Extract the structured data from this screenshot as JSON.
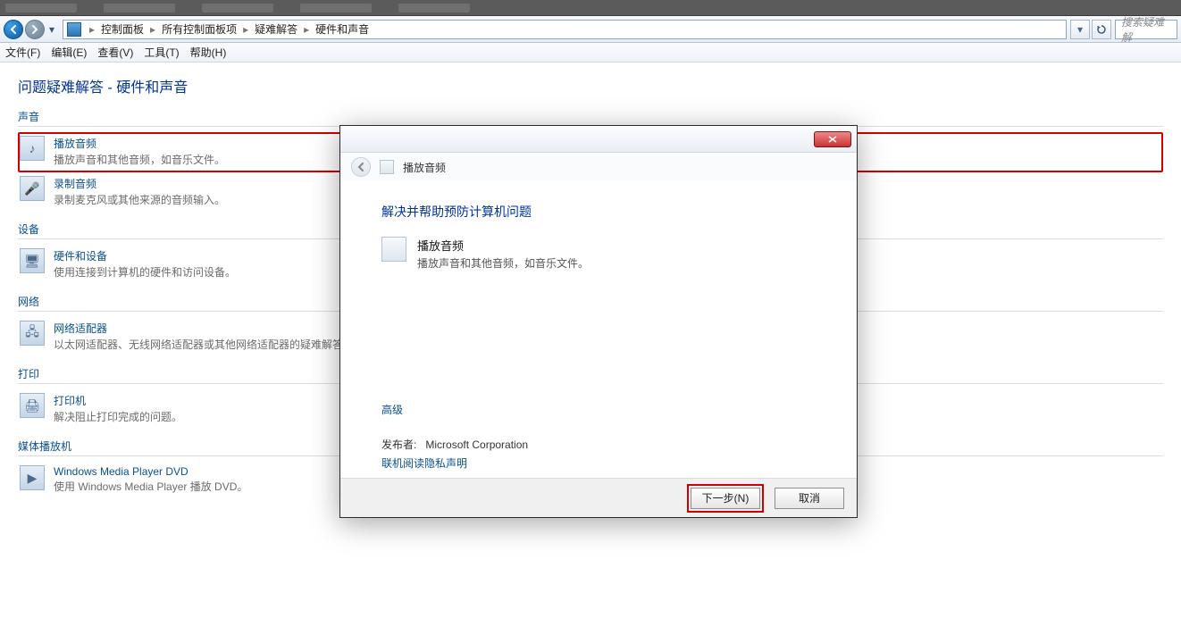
{
  "breadcrumb": {
    "parts": [
      "控制面板",
      "所有控制面板项",
      "疑难解答",
      "硬件和声音"
    ]
  },
  "search": {
    "placeholder": "搜索疑难解"
  },
  "menu": {
    "file": "文件(F)",
    "edit": "编辑(E)",
    "view": "查看(V)",
    "tools": "工具(T)",
    "help": "帮助(H)"
  },
  "page_title": "问题疑难解答 - 硬件和声音",
  "sections": {
    "sound": {
      "header": "声音",
      "items": [
        {
          "title": "播放音频",
          "desc": "播放声音和其他音频，如音乐文件。"
        },
        {
          "title": "录制音频",
          "desc": "录制麦克风或其他来源的音频输入。"
        }
      ]
    },
    "device": {
      "header": "设备",
      "items": [
        {
          "title": "硬件和设备",
          "desc": "使用连接到计算机的硬件和访问设备。"
        }
      ]
    },
    "network": {
      "header": "网络",
      "items": [
        {
          "title": "网络适配器",
          "desc": "以太网适配器、无线网络适配器或其他网络适配器的疑难解答。"
        }
      ]
    },
    "print": {
      "header": "打印",
      "items": [
        {
          "title": "打印机",
          "desc": "解决阻止打印完成的问题。"
        }
      ]
    },
    "media": {
      "header": "媒体播放机",
      "items": [
        {
          "title": "Windows Media Player DVD",
          "desc": "使用 Windows Media Player 播放 DVD。"
        }
      ]
    }
  },
  "dialog": {
    "subtitle": "播放音频",
    "heading": "解决并帮助预防计算机问题",
    "item_title": "播放音频",
    "item_desc": "播放声音和其他音频，如音乐文件。",
    "advanced": "高级",
    "publisher_label": "发布者:",
    "publisher_value": "Microsoft Corporation",
    "privacy_link": "联机阅读隐私声明",
    "next_btn": "下一步(N)",
    "cancel_btn": "取消"
  }
}
